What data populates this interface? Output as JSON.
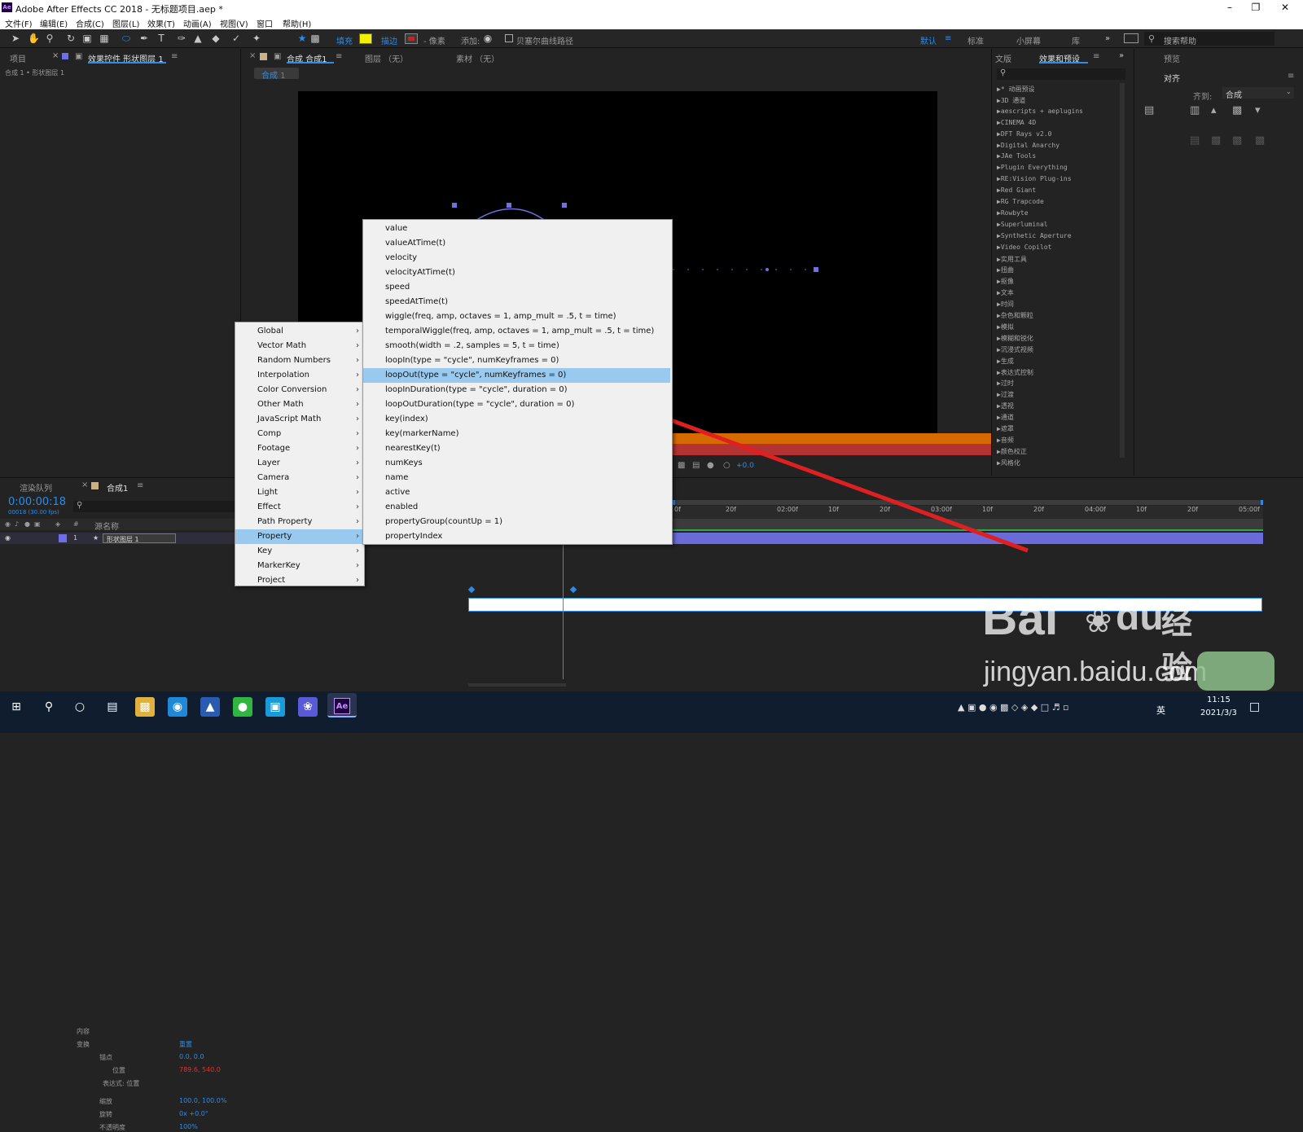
{
  "window": {
    "title": "Adobe After Effects CC 2018 - 无标题项目.aep *",
    "app_icon_text": "Ae"
  },
  "menubar": [
    "文件(F)",
    "编辑(E)",
    "合成(C)",
    "图层(L)",
    "效果(T)",
    "动画(A)",
    "视图(V)",
    "窗口",
    "帮助(H)"
  ],
  "toolbar": {
    "fill_label": "填充",
    "stroke_label": "描边",
    "stroke_px": "- 像素",
    "add_label": "添加:",
    "bezier_label": "贝塞尔曲线路径",
    "workspaces": [
      "默认",
      "标准",
      "小屏幕",
      "库"
    ],
    "search_placeholder": "搜索帮助",
    "fill_color": "#f2f200",
    "stroke_color": "#d81b1b",
    "accent": "#2d8ceb"
  },
  "project_panel": {
    "tab_project": "项目",
    "tab_effect_controls": "效果控件 形状图层 1",
    "breadcrumb": "合成 1 • 形状图层 1"
  },
  "comp_panel": {
    "tab_comp": "合成 合成1",
    "tab_layer": "图层 （无）",
    "tab_footage": "素材 （无）",
    "sub_tab": "合成 1",
    "offset_readout": "+0.0"
  },
  "right_panel": {
    "tab_text": "文版",
    "tab_effects": "效果和预设",
    "tab_preview": "预览",
    "align_title": "对齐",
    "align_to_label": "齐到:",
    "align_to_value": "合成",
    "effects": [
      "* 动画预设",
      "3D 通道",
      "aescripts + aeplugins",
      "CINEMA 4D",
      "DFT Rays v2.0",
      "Digital Anarchy",
      "JAe Tools",
      "Plugin Everything",
      "RE:Vision Plug-ins",
      "Red Giant",
      "RG Trapcode",
      "Rowbyte",
      "Superluminal",
      "Synthetic Aperture",
      "Video Copilot",
      "实用工具",
      "扭曲",
      "抠像",
      "文本",
      "时间",
      "杂色和颗粒",
      "模拟",
      "模糊和锐化",
      "沉浸式视频",
      "生成",
      "表达式控制",
      "过时",
      "过渡",
      "透视",
      "通道",
      "遮罩",
      "音频",
      "颜色校正",
      "风格化"
    ]
  },
  "timeline": {
    "tab_render": "渲染队列",
    "tab_comp": "合成1",
    "timecode": "0:00:00:18",
    "frames": "00018 (30.00 fps)",
    "col_source": "源名称",
    "layer_index": "1",
    "layer_name": "形状图层 1",
    "props": [
      {
        "label": "内容",
        "value": ""
      },
      {
        "label": "变换",
        "value": "重置"
      },
      {
        "label": "锚点",
        "value": "0.0, 0.0"
      },
      {
        "label": "位置",
        "value": "789.6, 540.0"
      },
      {
        "label": "表达式: 位置",
        "value": ""
      },
      {
        "label": "缩放",
        "value": "100.0, 100.0%"
      },
      {
        "label": "旋转",
        "value": "0x +0.0°"
      },
      {
        "label": "不透明度",
        "value": "100%"
      }
    ],
    "ruler": [
      "0f",
      "20f",
      "02:00f",
      "10f",
      "20f",
      "03:00f",
      "10f",
      "20f",
      "04:00f",
      "10f",
      "20f",
      "05:00f"
    ]
  },
  "expr_menu": {
    "categories": [
      "Global",
      "Vector Math",
      "Random Numbers",
      "Interpolation",
      "Color Conversion",
      "Other Math",
      "JavaScript Math",
      "Comp",
      "Footage",
      "Layer",
      "Camera",
      "Light",
      "Effect",
      "Path Property",
      "Property",
      "Key",
      "MarkerKey",
      "Project"
    ],
    "highlighted_category": "Property",
    "items": [
      "value",
      "valueAtTime(t)",
      "velocity",
      "velocityAtTime(t)",
      "speed",
      "speedAtTime(t)",
      "wiggle(freq, amp, octaves = 1, amp_mult = .5, t = time)",
      "temporalWiggle(freq, amp, octaves = 1, amp_mult = .5, t = time)",
      "smooth(width = .2, samples = 5, t = time)",
      "loopIn(type = \"cycle\", numKeyframes = 0)",
      "loopOut(type = \"cycle\", numKeyframes = 0)",
      "loopInDuration(type = \"cycle\", duration = 0)",
      "loopOutDuration(type = \"cycle\", duration = 0)",
      "key(index)",
      "key(markerName)",
      "nearestKey(t)",
      "numKeys",
      "name",
      "active",
      "enabled",
      "propertyGroup(countUp = 1)",
      "propertyIndex"
    ],
    "highlighted_item": "loopOut(type = \"cycle\", numKeyframes = 0)"
  },
  "watermark": {
    "brand": "Bai",
    "brand2": "du",
    "brand_cn": "经验",
    "url": "jingyan.baidu.com"
  },
  "taskbar": {
    "time": "11:15",
    "date": "2021/3/3",
    "ime": "英"
  }
}
